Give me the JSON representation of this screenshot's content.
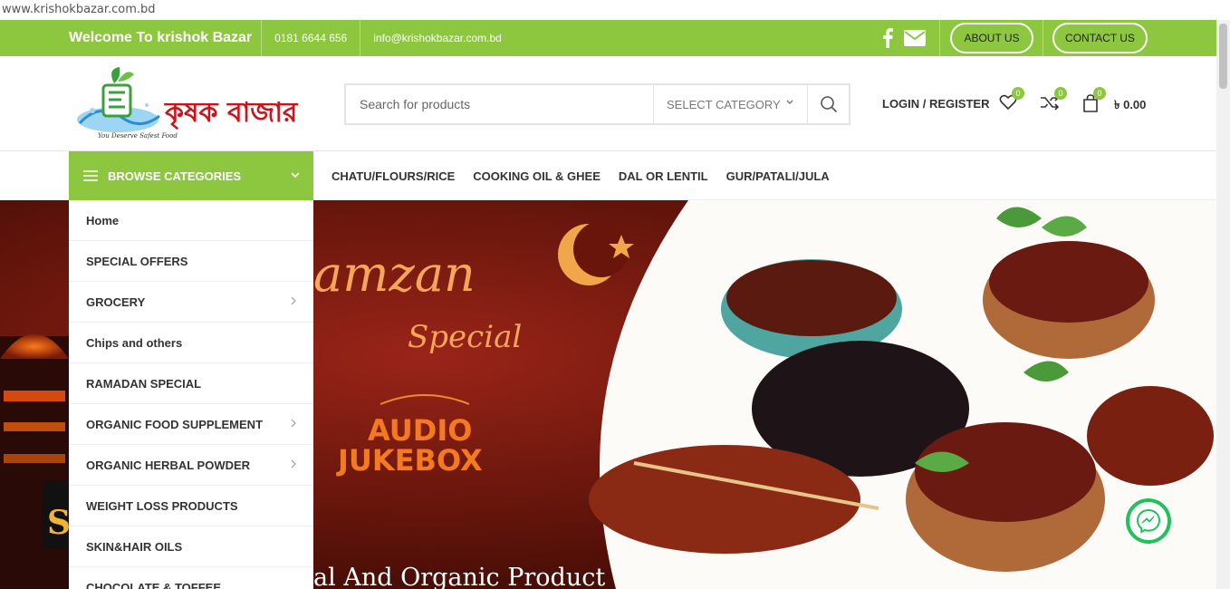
{
  "browser": {
    "url": "www.krishokbazar.com.bd"
  },
  "topbar": {
    "welcome": "Welcome To krishok Bazar",
    "phone": "0181 6644 656",
    "email": "info@krishokbazar.com.bd",
    "about_label": "ABOUT US",
    "contact_label": "CONTACT US",
    "bg_color": "#8dc63f"
  },
  "header": {
    "logo_text": "কৃষক বাজার",
    "logo_tagline": "You Deserve Safest Food",
    "search_placeholder": "Search for products",
    "category_label": "SELECT CATEGORY",
    "login_label": "LOGIN / REGISTER",
    "wishlist_count": "0",
    "compare_count": "0",
    "cart_count": "0",
    "cart_total": "৳ 0.00"
  },
  "nav": {
    "browse_label": "BROWSE CATEGORIES",
    "links": [
      "CHATU/FLOURS/RICE",
      "COOKING OIL & GHEE",
      "DAL OR LENTIL",
      "GUR/PATALI/JULA"
    ]
  },
  "menu": {
    "items": [
      {
        "label": "Home",
        "sub": false
      },
      {
        "label": "SPECIAL OFFERS",
        "sub": false
      },
      {
        "label": "GROCERY",
        "sub": true
      },
      {
        "label": "Chips and others",
        "sub": false
      },
      {
        "label": "RAMADAN SPECIAL",
        "sub": false
      },
      {
        "label": "ORGANIC FOOD SUPPLEMENT",
        "sub": true
      },
      {
        "label": "ORGANIC HERBAL POWDER",
        "sub": true
      },
      {
        "label": "WEIGHT LOSS PRODUCTS",
        "sub": false
      },
      {
        "label": "SKIN&HAIR OILS",
        "sub": false
      },
      {
        "label": "CHOCOLATE & TOFFEE",
        "sub": false
      }
    ]
  },
  "hero": {
    "title": "amzan",
    "subtitle": "Special",
    "audio_line1": "AUDIO",
    "audio_line2": "JUKEBOX",
    "bottom_text": "al And Organic Product"
  }
}
